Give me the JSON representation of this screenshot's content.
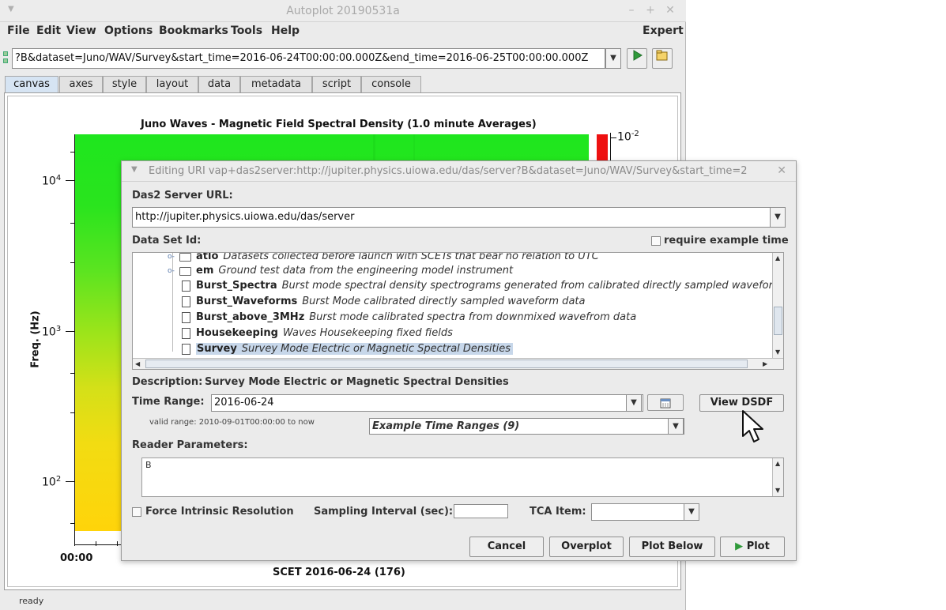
{
  "app": {
    "title": "Autoplot 20190531a",
    "menus": [
      "File",
      "Edit",
      "View",
      "Options",
      "Bookmarks",
      "Tools",
      "Help"
    ],
    "menu_right": "Expert",
    "url": "?B&dataset=Juno/WAV/Survey&start_time=2016-06-24T00:00:00.000Z&end_time=2016-06-25T00:00:00.000Z",
    "tabs": [
      "canvas",
      "axes",
      "style",
      "layout",
      "data",
      "metadata",
      "script",
      "console"
    ],
    "active_tab": "canvas",
    "status": "ready"
  },
  "plot": {
    "title": "Juno Waves - Magnetic Field Spectral Density (1.0 minute Averages)",
    "ylabel": "Freq. (Hz)",
    "y_ticks": [
      {
        "base": "10",
        "exp": "4"
      },
      {
        "base": "10",
        "exp": "3"
      },
      {
        "base": "10",
        "exp": "2"
      }
    ],
    "x_tick": "00:00",
    "xlabel": "SCET 2016-06-24 (176)",
    "colorbar_label": {
      "base": "10",
      "exp": "-2"
    },
    "scale": "log",
    "colors": {
      "top": "#1ee61e",
      "bottom": "#ffd40a",
      "colorbar": "#ee1111"
    }
  },
  "dialog": {
    "title": "Editing URI vap+das2server:http://jupiter.physics.uiowa.edu/das/server?B&dataset=Juno/WAV/Survey&start_time=2",
    "server_label": "Das2 Server URL:",
    "server_url": "http://jupiter.physics.uiowa.edu/das/server",
    "dataset_label": "Data Set Id:",
    "require_example_label": "require example time",
    "tree": [
      {
        "name": "atlo",
        "desc": "Datasets collected before launch with SCETs that bear no relation to UTC",
        "kind": "folder"
      },
      {
        "name": "em",
        "desc": "Ground test data from the engineering model instrument",
        "kind": "folder"
      },
      {
        "name": "Burst_Spectra",
        "desc": "Burst mode spectral density spectrograms generated from calibrated directly sampled waveform da",
        "kind": "file"
      },
      {
        "name": "Burst_Waveforms",
        "desc": "Burst Mode calibrated directly sampled waveform data",
        "kind": "file"
      },
      {
        "name": "Burst_above_3MHz",
        "desc": "Burst mode calibrated spectra from downmixed wavefrom data",
        "kind": "file"
      },
      {
        "name": "Housekeeping",
        "desc": "Waves Housekeeping fixed fields",
        "kind": "file"
      },
      {
        "name": "Survey",
        "desc": "Survey Mode Electric or Magnetic Spectral Densities",
        "kind": "file",
        "selected": true
      }
    ],
    "description_label": "Description:",
    "description": "Survey Mode Electric or Magnetic Spectral Densities",
    "time_range_label": "Time Range:",
    "time_range": "2016-06-24",
    "view_dsdf_label": "View DSDF",
    "valid_range": "valid range: 2010-09-01T00:00:00 to now",
    "example_ranges": "Example Time Ranges (9)",
    "reader_params_label": "Reader Parameters:",
    "reader_params": "B",
    "force_intrinsic_label": "Force Intrinsic Resolution",
    "sampling_label": "Sampling Interval (sec):",
    "sampling_value": "",
    "tca_label": "TCA Item:",
    "buttons": {
      "cancel": "Cancel",
      "overplot": "Overplot",
      "plot_below": "Plot Below",
      "plot": "Plot"
    }
  }
}
